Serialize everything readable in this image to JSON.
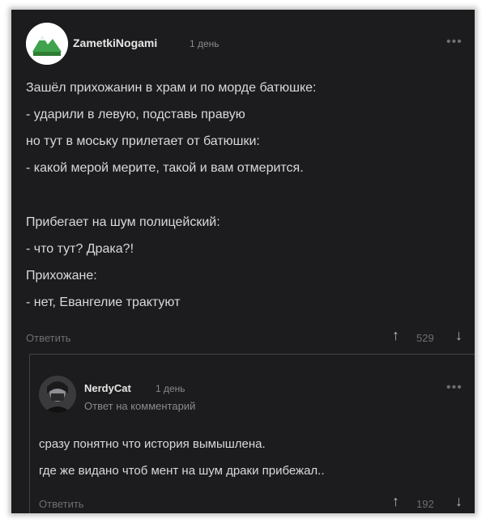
{
  "comment": {
    "author": "ZametkiNogami",
    "time": "1 день",
    "lines": [
      "Зашёл прихожанин в храм и по морде батюшке:",
      "- ударили в левую, подставь правую",
      "но тут в моську прилетает от батюшки:",
      "- какой мерой мерите, такой и вам отмерится.",
      "Прибегает на шум полицейский:",
      "- что тут? Драка?!",
      "Прихожане:",
      "- нет, Евангелие трактуют"
    ],
    "reply_label": "Ответить",
    "score": "529",
    "more": "•••"
  },
  "reply": {
    "author": "NerdyCat",
    "time": "1 день",
    "subtitle": "Ответ на комментарий",
    "lines": [
      "сразу понятно что история вымышлена.",
      "где же видано чтоб мент на шум драки прибежал.."
    ],
    "reply_label": "Ответить",
    "score": "192",
    "more": "•••"
  },
  "icons": {
    "upvote": "↑",
    "downvote": "↓"
  },
  "colors": {
    "background": "#1c1c1e",
    "text": "#d9d9dc",
    "muted": "#6e6e73"
  }
}
